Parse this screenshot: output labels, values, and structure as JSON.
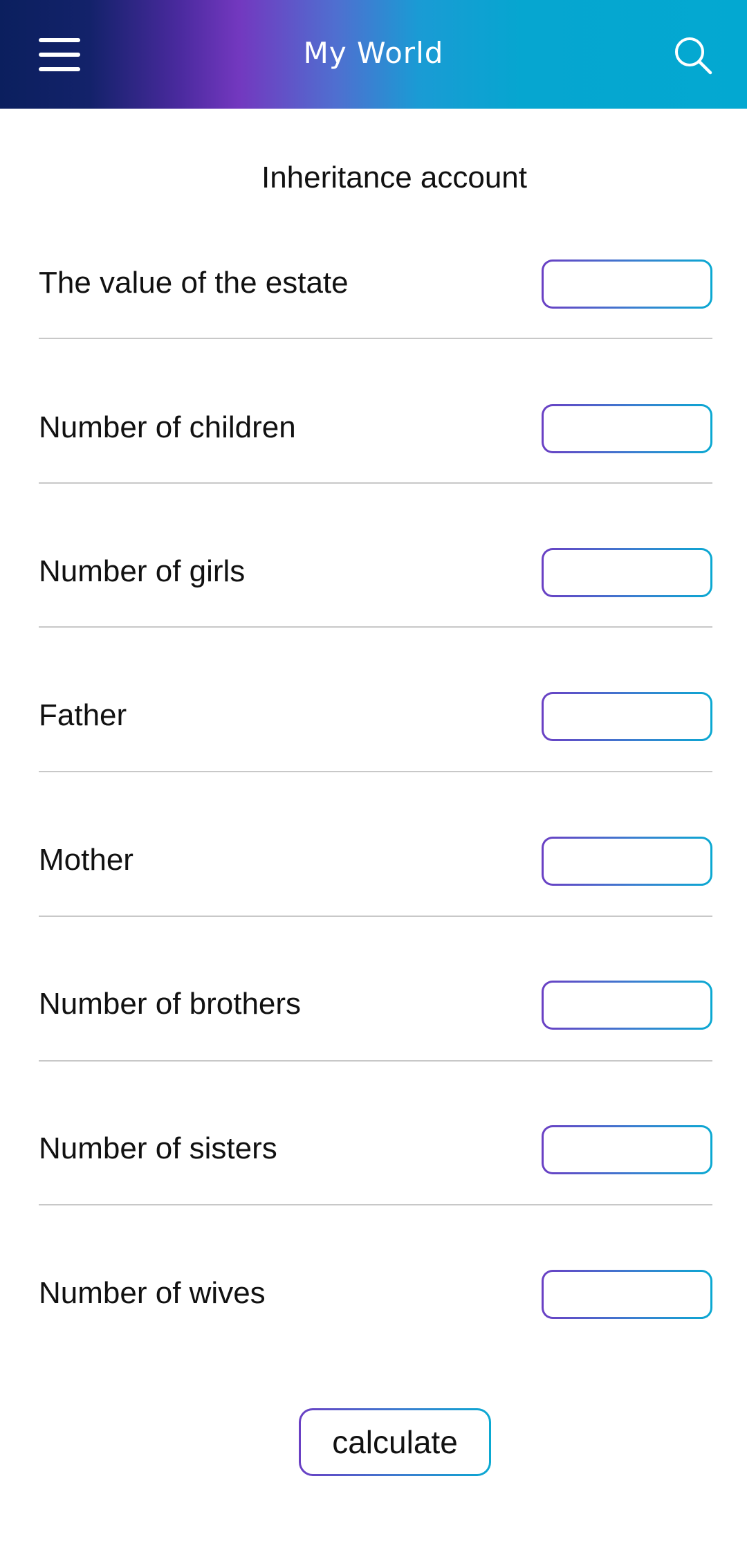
{
  "header": {
    "title": "My World",
    "menu_icon": "hamburger-menu-icon",
    "search_icon": "search-icon",
    "gradient_colors": [
      "#0b1f5e",
      "#7338bf",
      "#03a8d1"
    ]
  },
  "form": {
    "title": "Inheritance account",
    "fields": [
      {
        "label": "The value of the estate",
        "value": ""
      },
      {
        "label": "Number of children",
        "value": ""
      },
      {
        "label": "Number of girls",
        "value": ""
      },
      {
        "label": "Father",
        "value": ""
      },
      {
        "label": "Mother",
        "value": ""
      },
      {
        "label": "Number of brothers",
        "value": ""
      },
      {
        "label": "Number of sisters",
        "value": ""
      },
      {
        "label": "Number of wives",
        "value": ""
      }
    ],
    "calculate_label": "calculate",
    "field_border_colors": [
      "#6a3fc4",
      "#0aa9d2"
    ]
  }
}
